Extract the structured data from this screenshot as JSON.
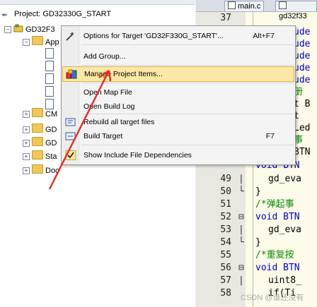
{
  "project_panel": {
    "title": "Project: GD32330G_START",
    "target_label": "GD32F3",
    "tree": [
      {
        "label": "App"
      },
      {
        "label": "CM"
      },
      {
        "label": "GD"
      },
      {
        "label": "GD"
      },
      {
        "label": "Sta"
      },
      {
        "label": "Doc"
      }
    ]
  },
  "editor": {
    "tabs": [
      {
        "label": "main.c"
      },
      {
        "label": "gd32f33"
      }
    ],
    "current_line": "37",
    "lines": [
      {
        "n": "49",
        "fold": "|",
        "code": "gd_eva"
      },
      {
        "n": "50",
        "fold": "└",
        "code": "}"
      },
      {
        "n": "51",
        "fold": "",
        "code": "/*弹起事"
      },
      {
        "n": "52",
        "fold": "⊟",
        "code": "void BTN"
      },
      {
        "n": "53",
        "fold": "|",
        "code": "gd_eva"
      },
      {
        "n": "54",
        "fold": "└",
        "code": "}"
      },
      {
        "n": "55",
        "fold": "",
        "code": "/*重复按"
      },
      {
        "n": "56",
        "fold": "⊟",
        "code": "void BTN"
      },
      {
        "n": "57",
        "fold": "|",
        "code": "uint8_"
      },
      {
        "n": "58",
        "fold": "",
        "code": "if(Ti"
      }
    ],
    "fragments": [
      {
        "text": "ude",
        "cls": ""
      },
      {
        "text": "ude",
        "cls": ""
      },
      {
        "text": "ude",
        "cls": ""
      },
      {
        "text": "ude",
        "cls": ""
      },
      {
        "text": "ude",
        "cls": ""
      },
      {
        "text": "册",
        "cls": "gr"
      },
      {
        "text": "t B",
        "cls": "dk"
      },
      {
        "text": "t",
        "cls": "dk"
      },
      {
        "text": "Led",
        "cls": "dk"
      },
      {
        "text": "事",
        "cls": "gr"
      },
      {
        "text": "BTN",
        "cls": "dk"
      }
    ],
    "partial_line_text": "void BTN",
    "watermark": "CSDN @谁还没有"
  },
  "context_menu": {
    "items": [
      {
        "label": "Options for Target 'GD32F330G_START'...",
        "shortcut": "Alt+F7",
        "icon": "options-wand-icon"
      },
      {
        "label": "Add Group...",
        "shortcut": "",
        "icon": ""
      },
      {
        "label": "Manage Project Items...",
        "shortcut": "",
        "icon": "manage-project-items-icon"
      },
      {
        "label": "Open Map File",
        "shortcut": "",
        "icon": ""
      },
      {
        "label": "Open Build Log",
        "shortcut": "",
        "icon": ""
      },
      {
        "label": "Rebuild all target files",
        "shortcut": "",
        "icon": "rebuild-icon"
      },
      {
        "label": "Build Target",
        "shortcut": "F7",
        "icon": "build-icon"
      },
      {
        "label": "Show Include File Dependencies",
        "shortcut": "",
        "icon": "check-icon"
      }
    ],
    "highlighted_index": 2
  },
  "colors": {
    "menu_highlight": "#fbe7a6",
    "annotation_arrow": "#e2312a",
    "editor_background": "#fdfbe9"
  }
}
